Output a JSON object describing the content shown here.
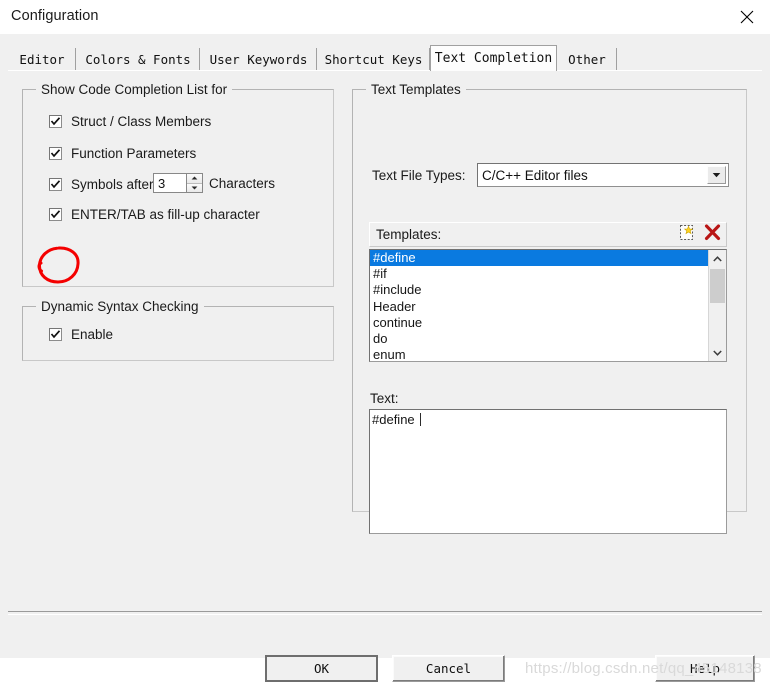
{
  "window": {
    "title": "Configuration",
    "close_icon": "close-icon"
  },
  "tabs": [
    {
      "label": "Editor",
      "active": false
    },
    {
      "label": "Colors & Fonts",
      "active": false
    },
    {
      "label": "User Keywords",
      "active": false
    },
    {
      "label": "Shortcut Keys",
      "active": false
    },
    {
      "label": "Text Completion",
      "active": true
    },
    {
      "label": "Other",
      "active": false
    }
  ],
  "show_completion_group": {
    "title": "Show Code Completion List for",
    "items": [
      {
        "label": "Struct / Class Members",
        "checked": true
      },
      {
        "label": "Function Parameters",
        "checked": true
      },
      {
        "label": "Symbols after",
        "checked": true,
        "suffix": "Characters",
        "value": "3"
      },
      {
        "label": "ENTER/TAB as fill-up character",
        "checked": true,
        "annotated": true
      }
    ]
  },
  "dynamic_syntax_group": {
    "title": "Dynamic Syntax Checking",
    "enable": {
      "label": "Enable",
      "checked": true
    }
  },
  "text_templates_group": {
    "title": "Text Templates",
    "file_types_label": "Text File Types:",
    "file_types_value": "C/C++ Editor files",
    "templates_label": "Templates:",
    "new_icon": "new-template-icon",
    "delete_icon": "delete-template-icon",
    "templates": [
      {
        "name": "#define",
        "selected": true
      },
      {
        "name": "#if",
        "selected": false
      },
      {
        "name": "#include",
        "selected": false
      },
      {
        "name": "Header",
        "selected": false
      },
      {
        "name": "continue",
        "selected": false
      },
      {
        "name": "do",
        "selected": false
      },
      {
        "name": "enum",
        "selected": false
      }
    ],
    "text_label": "Text:",
    "text_value": "#define "
  },
  "buttons": {
    "ok": "OK",
    "cancel": "Cancel",
    "help": "Help"
  },
  "watermark": "https://blog.csdn.net/qq_45148138",
  "colors": {
    "selection": "#0a7ae0",
    "annotation": "#f40000",
    "dialog_face": "#f0f0f0"
  }
}
